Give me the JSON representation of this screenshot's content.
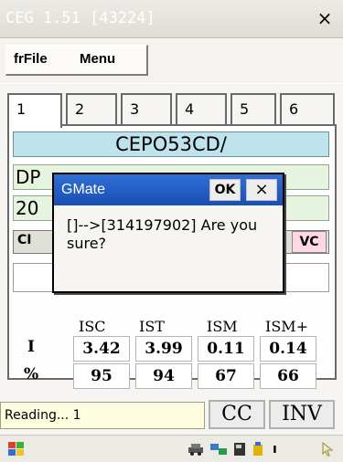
{
  "window": {
    "title": "CEG 1.51 [43224]"
  },
  "menu": {
    "items": [
      "frFile",
      "Menu"
    ]
  },
  "tabs": [
    "1",
    "2",
    "3",
    "4",
    "5",
    "6"
  ],
  "device_id": "CEPO53CD/",
  "fields": {
    "row1": "DP",
    "row2": "20"
  },
  "buttons": {
    "left": "CI",
    "right": "VC"
  },
  "dialog": {
    "title": "GMate",
    "ok_label": "OK",
    "close_label": "×",
    "message": "[]-->[314197902] Are you sure?"
  },
  "table": {
    "columns": [
      "ISC",
      "IST",
      "ISM",
      "ISM+"
    ],
    "rows": [
      {
        "label": "I",
        "values": [
          "3.42",
          "3.99",
          "0.11",
          "0.14"
        ]
      },
      {
        "label": "%",
        "values": [
          "95",
          "94",
          "67",
          "66"
        ]
      }
    ]
  },
  "status": {
    "text": "Reading... 1",
    "cc_label": "CC",
    "inv_label": "INV"
  },
  "taskbar": {
    "icons": [
      "windows-flag-icon",
      "car-icon",
      "network-icon",
      "card-icon",
      "usb-icon",
      "info-icon",
      "pointer-icon"
    ]
  }
}
